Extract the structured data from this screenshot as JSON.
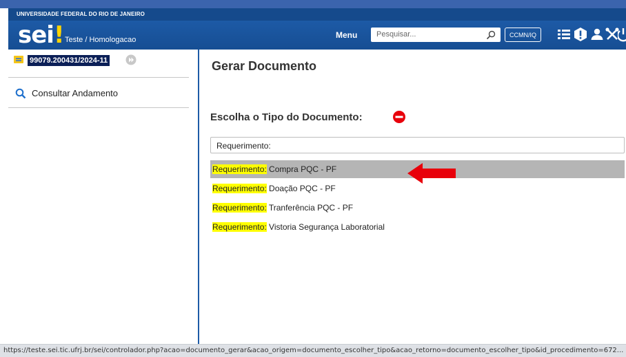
{
  "university": "UNIVERSIDADE FEDERAL DO RIO DE JANEIRO",
  "header": {
    "logo": "sei",
    "logo_mark": "!",
    "environment": "Teste / Homologacao",
    "menu_label": "Menu",
    "search_placeholder": "Pesquisar...",
    "unit": "CCMN/IQ",
    "icons": [
      "list-icon",
      "alert-icon",
      "user-icon",
      "tools-icon",
      "power-icon"
    ]
  },
  "sidebar": {
    "process_number": "99079.200431/2024-11",
    "consult_label": "Consultar Andamento"
  },
  "main": {
    "title": "Gerar Documento",
    "choose_label": "Escolha o Tipo do Documento:",
    "filter_value": "Requerimento:",
    "options": [
      {
        "prefix": "Requerimento:",
        "name": " Compra PQC - PF",
        "selected": true
      },
      {
        "prefix": "Requerimento:",
        "name": " Doação PQC - PF",
        "selected": false
      },
      {
        "prefix": "Requerimento:",
        "name": " Tranferência PQC - PF",
        "selected": false
      },
      {
        "prefix": "Requerimento:",
        "name": " Vistoria Segurança Laboratorial",
        "selected": false
      }
    ]
  },
  "status_url": "https://teste.sei.tic.ufrj.br/sei/controlador.php?acao=documento_gerar&acao_origem=documento_escolher_tipo&acao_retorno=documento_escolher_tipo&id_procedimento=672...",
  "colors": {
    "header": "#1d5aa6",
    "university_bar": "#154a8c",
    "process_badge": "#0b1f57",
    "highlight": "#ffff00",
    "selected_row": "#b5b5b5",
    "annotation_arrow": "#e8000b"
  }
}
